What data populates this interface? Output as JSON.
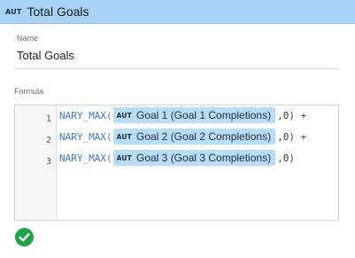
{
  "header": {
    "tag": "AUT",
    "title": "Total Goals"
  },
  "name_field": {
    "label": "Name",
    "value": "Total Goals"
  },
  "formula": {
    "label": "Formula",
    "lines": [
      {
        "number": "1",
        "function": "NARY_MAX(",
        "metric_tag": "AUT",
        "metric": "Goal 1 (Goal 1 Completions)",
        "suffix": ",0) +"
      },
      {
        "number": "2",
        "function": "NARY_MAX(",
        "metric_tag": "AUT",
        "metric": "Goal 2 (Goal 2 Completions)",
        "suffix": ",0) +"
      },
      {
        "number": "3",
        "function": "NARY_MAX(",
        "metric_tag": "AUT",
        "metric": "Goal 3 (Goal 3 Completions)",
        "suffix": ",0)"
      }
    ]
  },
  "status": {
    "icon": "check-circle-icon",
    "color": "#22a24a"
  },
  "colors": {
    "header_bg": "#a8d3f6",
    "chip_bg": "#b9dcf7",
    "function_text": "#3b7bbd"
  }
}
